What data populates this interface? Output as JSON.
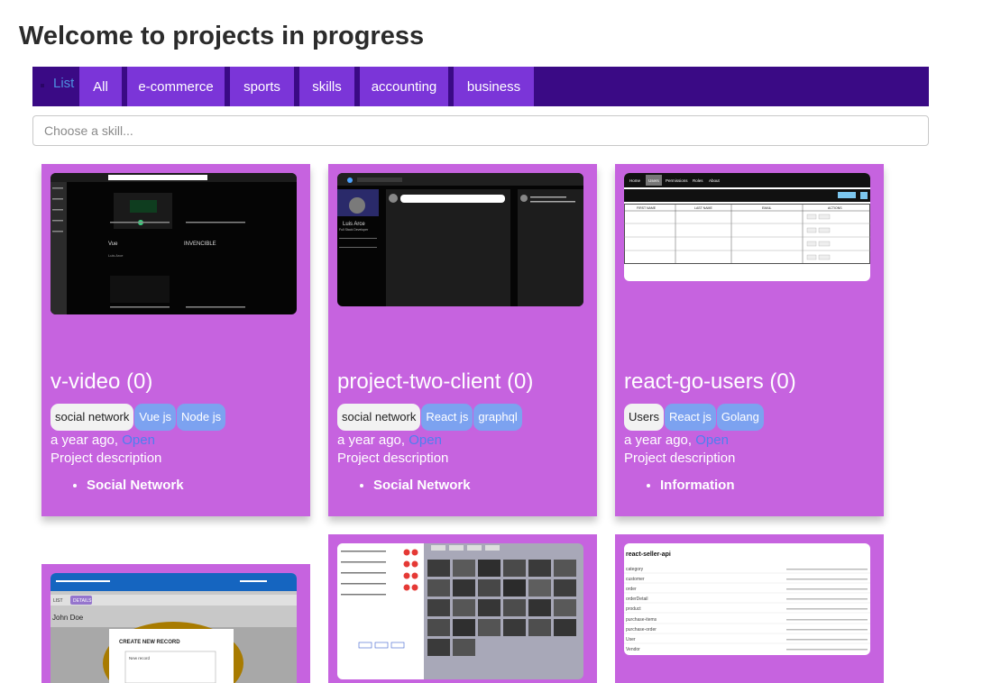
{
  "page": {
    "title": "Welcome to projects in progress"
  },
  "nav": {
    "list_label": "List",
    "tabs": [
      "All",
      "e-commerce",
      "sports",
      "skills",
      "accounting",
      "business"
    ]
  },
  "search": {
    "placeholder": "Choose a skill..."
  },
  "cards": [
    {
      "title": "v-video (0)",
      "tags": [
        "social network",
        "Vue js",
        "Node js"
      ],
      "time": "a year ago,",
      "status": "Open",
      "description": "Project description",
      "category": "Social Network",
      "preview_text": [
        "Vue",
        "INVENCIBLE",
        "Luis Arce"
      ]
    },
    {
      "title": "project-two-client (0)",
      "tags": [
        "social network",
        "React js",
        "graphql"
      ],
      "time": "a year ago,",
      "status": "Open",
      "description": "Project description",
      "category": "Social Network",
      "preview_text": [
        "Luis Arce",
        "Full Stack Developer"
      ]
    },
    {
      "title": "react-go-users (0)",
      "tags": [
        "Users",
        "React js",
        "Golang"
      ],
      "time": "a year ago,",
      "status": "Open",
      "description": "Project description",
      "category": "Information",
      "preview_text": [
        "Home",
        "Users",
        "Permissions",
        "Roles",
        "About",
        "FIRST NAME",
        "LAST NAME",
        "EMAIL",
        "ACTIONS"
      ]
    },
    {
      "preview_text": [
        "John Doe",
        "CREATE NEW RECORD",
        "New record",
        "LIST",
        "DETAILS"
      ]
    },
    {
      "preview_text": []
    },
    {
      "preview_text": [
        "react-seller-api",
        "category",
        "customer",
        "order",
        "orderDetail",
        "product",
        "purchase-items",
        "purchase-order",
        "User",
        "Vendor"
      ]
    }
  ],
  "colors": {
    "navbar": "#3a0a85",
    "tab": "#7b35d8",
    "card": "#c663df",
    "tag": "#7ca2f0",
    "link": "#4d7ef0"
  }
}
